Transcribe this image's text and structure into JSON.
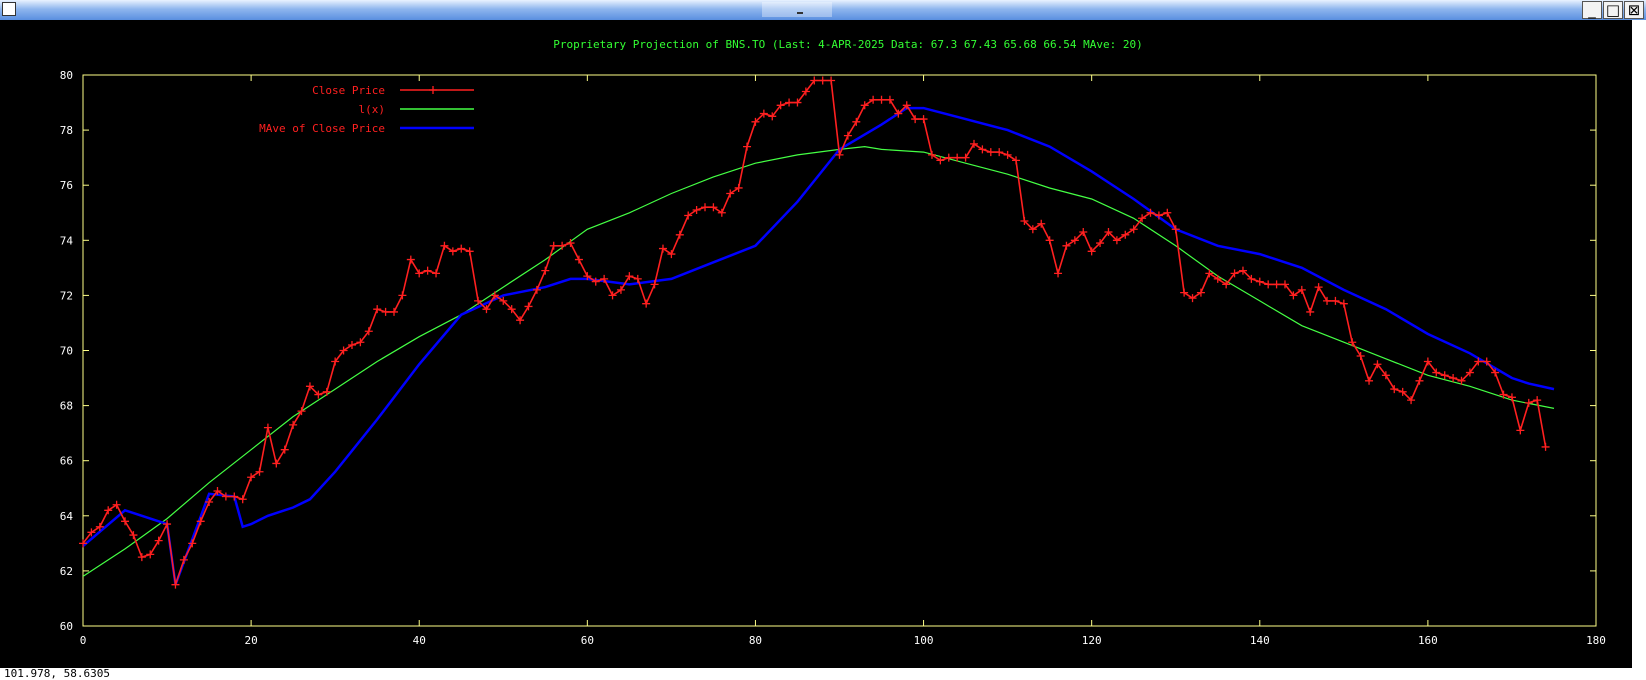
{
  "window": {
    "minimize_icon": "minimize-icon",
    "maximize_icon": "maximize-icon",
    "close_icon": "close-icon"
  },
  "status": {
    "coords": "101.978,  58.6305"
  },
  "colors": {
    "background": "#000000",
    "axes": "#ffff88",
    "title": "#33ff33",
    "close": "#ff2020",
    "fit": "#44ff44",
    "mave": "#0000ff"
  },
  "chart_data": {
    "type": "line",
    "title": "Proprietary Projection of BNS.TO  (Last:  4-APR-2025   Data: 67.3 67.43 65.68 66.54   MAve: 20)",
    "xlim": [
      0,
      180
    ],
    "ylim": [
      60,
      80
    ],
    "xticks": [
      0,
      20,
      40,
      60,
      80,
      100,
      120,
      140,
      160,
      180
    ],
    "yticks": [
      60,
      62,
      64,
      66,
      68,
      70,
      72,
      74,
      76,
      78,
      80
    ],
    "legend_position": "top-left",
    "grid": false,
    "series": [
      {
        "name": "Close Price",
        "color": "#ff2020",
        "marker": "+",
        "x": [
          0,
          1,
          2,
          3,
          4,
          5,
          6,
          7,
          8,
          9,
          10,
          11,
          12,
          13,
          14,
          15,
          16,
          17,
          18,
          19,
          20,
          21,
          22,
          23,
          24,
          25,
          26,
          27,
          28,
          29,
          30,
          31,
          32,
          33,
          34,
          35,
          36,
          37,
          38,
          39,
          40,
          41,
          42,
          43,
          44,
          45,
          46,
          47,
          48,
          49,
          50,
          51,
          52,
          53,
          54,
          55,
          56,
          57,
          58,
          59,
          60,
          61,
          62,
          63,
          64,
          65,
          66,
          67,
          68,
          69,
          70,
          71,
          72,
          73,
          74,
          75,
          76,
          77,
          78,
          79,
          80,
          81,
          82,
          83,
          84,
          85,
          86,
          87,
          88,
          89,
          90,
          91,
          92,
          93,
          94,
          95,
          96,
          97,
          98,
          99,
          100,
          101,
          102,
          103,
          104,
          105,
          106,
          107,
          108,
          109,
          110,
          111,
          112,
          113,
          114,
          115,
          116,
          117,
          118,
          119,
          120,
          121,
          122,
          123,
          124,
          125,
          126,
          127,
          128,
          129,
          130,
          131,
          132,
          133,
          134,
          135,
          136,
          137,
          138,
          139,
          140,
          141,
          142,
          143,
          144,
          145,
          146,
          147,
          148,
          149,
          150,
          151,
          152,
          153,
          154,
          155,
          156,
          157,
          158,
          159,
          160,
          161,
          162,
          163,
          164,
          165,
          166,
          167,
          168,
          169,
          170,
          171,
          172,
          173,
          174
        ],
        "y": [
          63.0,
          63.4,
          63.6,
          64.2,
          64.4,
          63.8,
          63.3,
          62.5,
          62.6,
          63.1,
          63.7,
          61.5,
          62.4,
          63.0,
          63.8,
          64.5,
          64.9,
          64.7,
          64.7,
          64.6,
          65.4,
          65.6,
          67.2,
          65.9,
          66.4,
          67.3,
          67.8,
          68.7,
          68.4,
          68.5,
          69.6,
          70.0,
          70.2,
          70.3,
          70.7,
          71.5,
          71.4,
          71.4,
          72.0,
          73.3,
          72.8,
          72.9,
          72.8,
          73.8,
          73.6,
          73.7,
          73.6,
          71.8,
          71.5,
          72.0,
          71.8,
          71.5,
          71.1,
          71.6,
          72.2,
          72.9,
          73.8,
          73.8,
          73.9,
          73.3,
          72.7,
          72.5,
          72.6,
          72.0,
          72.2,
          72.7,
          72.6,
          71.7,
          72.4,
          73.7,
          73.5,
          74.2,
          74.9,
          75.1,
          75.2,
          75.2,
          75.0,
          75.7,
          75.9,
          77.4,
          78.3,
          78.6,
          78.5,
          78.9,
          79.0,
          79.0,
          79.4,
          79.8,
          79.8,
          79.8,
          77.1,
          77.8,
          78.3,
          78.9,
          79.1,
          79.1,
          79.1,
          78.6,
          78.9,
          78.4,
          78.4,
          77.1,
          76.9,
          77.0,
          77.0,
          77.0,
          77.5,
          77.3,
          77.2,
          77.2,
          77.1,
          76.9,
          74.7,
          74.4,
          74.6,
          74.0,
          72.8,
          73.8,
          74.0,
          74.3,
          73.6,
          73.9,
          74.3,
          74.0,
          74.2,
          74.4,
          74.8,
          75.0,
          74.9,
          75.0,
          74.4,
          72.1,
          71.9,
          72.1,
          72.8,
          72.6,
          72.4,
          72.8,
          72.9,
          72.6,
          72.5,
          72.4,
          72.4,
          72.4,
          72.0,
          72.2,
          71.4,
          72.3,
          71.8,
          71.8,
          71.7,
          70.3,
          69.8,
          68.9,
          69.5,
          69.1,
          68.6,
          68.5,
          68.2,
          68.9,
          69.6,
          69.2,
          69.1,
          69.0,
          68.9,
          69.2,
          69.6,
          69.6,
          69.2,
          68.4,
          68.3,
          67.1,
          68.1,
          68.2,
          66.5
        ]
      },
      {
        "name": "l(x)",
        "color": "#44ff44",
        "marker": "",
        "x": [
          0,
          5,
          10,
          15,
          20,
          25,
          30,
          35,
          40,
          45,
          50,
          55,
          60,
          65,
          70,
          75,
          80,
          85,
          90,
          93,
          95,
          100,
          105,
          110,
          115,
          120,
          125,
          130,
          135,
          140,
          145,
          150,
          155,
          160,
          165,
          170,
          175
        ],
        "y": [
          61.8,
          62.8,
          63.9,
          65.2,
          66.4,
          67.6,
          68.6,
          69.6,
          70.5,
          71.3,
          72.3,
          73.3,
          74.4,
          75.0,
          75.7,
          76.3,
          76.8,
          77.1,
          77.3,
          77.4,
          77.3,
          77.2,
          76.8,
          76.4,
          75.9,
          75.5,
          74.8,
          73.8,
          72.7,
          71.8,
          70.9,
          70.3,
          69.7,
          69.1,
          68.7,
          68.2,
          67.9
        ]
      },
      {
        "name": "MAve of Close Price",
        "color": "#0000ff",
        "marker": "",
        "x": [
          0,
          5,
          10,
          11,
          15,
          18,
          19,
          20,
          22,
          25,
          27,
          30,
          35,
          40,
          45,
          50,
          55,
          58,
          60,
          65,
          70,
          75,
          80,
          85,
          90,
          95,
          98,
          100,
          105,
          110,
          115,
          120,
          125,
          130,
          135,
          140,
          145,
          150,
          155,
          160,
          165,
          170,
          172,
          175
        ],
        "y": [
          62.9,
          64.2,
          63.7,
          61.5,
          64.8,
          64.7,
          63.6,
          63.7,
          64.0,
          64.3,
          64.6,
          65.6,
          67.5,
          69.5,
          71.3,
          72.0,
          72.3,
          72.6,
          72.6,
          72.4,
          72.6,
          73.2,
          73.8,
          75.4,
          77.3,
          78.2,
          78.8,
          78.8,
          78.4,
          78.0,
          77.4,
          76.5,
          75.5,
          74.4,
          73.8,
          73.5,
          73.0,
          72.2,
          71.5,
          70.6,
          69.9,
          69.0,
          68.8,
          68.6
        ]
      }
    ]
  }
}
